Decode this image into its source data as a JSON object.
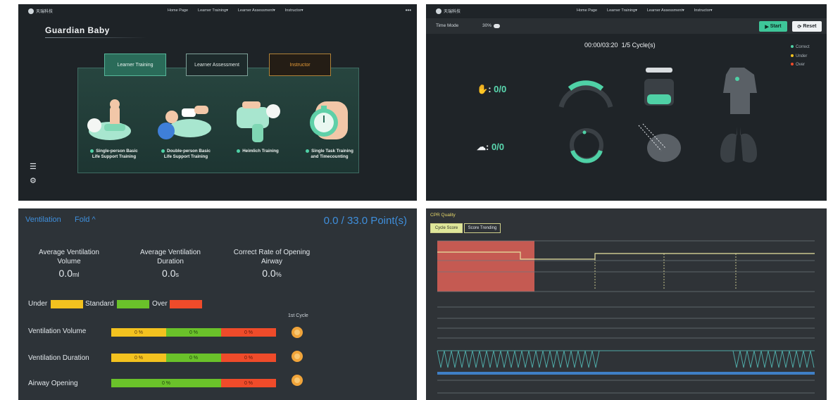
{
  "colors": {
    "accent_green": "#4fd1a6",
    "accent_blue": "#3f8fdc",
    "under_yellow": "#f3c21f",
    "standard_green": "#6ac22a",
    "over_red": "#ef4b2a",
    "instructor_orange": "#e49a37"
  },
  "panel1": {
    "logo_text": "天瑞科技",
    "nav": [
      "Home Page",
      "Learner Training▾",
      "Learner Assessment▾",
      "Instructor▾"
    ],
    "more_icon": "more-icon",
    "title": "Guardian Baby",
    "tabs": [
      "Learner Training",
      "Learner Assessment",
      "Instructor"
    ],
    "cards": [
      {
        "line1": "Single-person Basic",
        "line2": "Life Support Training",
        "icon": "single-cpr-icon"
      },
      {
        "line1": "Double-person Basic",
        "line2": "Life Support Training",
        "icon": "double-cpr-icon"
      },
      {
        "line1": "Heimlich Training",
        "line2": "",
        "icon": "heimlich-icon"
      },
      {
        "line1": "Single Task Training",
        "line2": "and Timecounting",
        "icon": "stopwatch-icon"
      }
    ],
    "side_icons": [
      "menu-icon",
      "gear-icon"
    ]
  },
  "panel2": {
    "logo_text": "天瑞科技",
    "nav": [
      "Home Page",
      "Learner Training▾",
      "Learner Assessment▾",
      "Instructor▾"
    ],
    "time_mode_label": "Time Mode",
    "time_mode_value": "30%",
    "start_label": "Start",
    "reset_label": "Reset",
    "timer": "00:00/03:20",
    "cycle": "1/5",
    "cycle_label": "Cycle(s)",
    "legend": [
      {
        "label": "Correct",
        "color": "#4fd1a6"
      },
      {
        "label": "Under",
        "color": "#f3c21f"
      },
      {
        "label": "Over",
        "color": "#ef4b2a"
      }
    ],
    "compression_score": "0/0",
    "ventilation_score": "0/0"
  },
  "panel3": {
    "ventilation_label": "Ventilation",
    "fold_label": "Fold ^",
    "points": "0.0 / 33.0 Point(s)",
    "metrics": [
      {
        "line1": "Average Ventilation",
        "line2": "Volume",
        "value": "0.0",
        "unit": "ml"
      },
      {
        "line1": "Average Ventilation",
        "line2": "Duration",
        "value": "0.0",
        "unit": "s"
      },
      {
        "line1": "Correct Rate of Opening",
        "line2": "Airway",
        "value": "0.0",
        "unit": "%"
      }
    ],
    "legend": {
      "under": "Under",
      "standard": "Standard",
      "over": "Over"
    },
    "cycle_label": "1st Cycle",
    "rows": [
      {
        "label": "Ventilation Volume",
        "segments": [
          "0 %",
          "0 %",
          "0 %"
        ]
      },
      {
        "label": "Ventilation Duration",
        "segments": [
          "0 %",
          "0 %",
          "0 %"
        ]
      },
      {
        "label": "Airway Opening",
        "segments": [
          "0 %",
          "0 %"
        ]
      }
    ]
  },
  "panel4": {
    "title": "CPR Quality",
    "tabs": [
      "Cycle Score",
      "Score Trending"
    ]
  }
}
